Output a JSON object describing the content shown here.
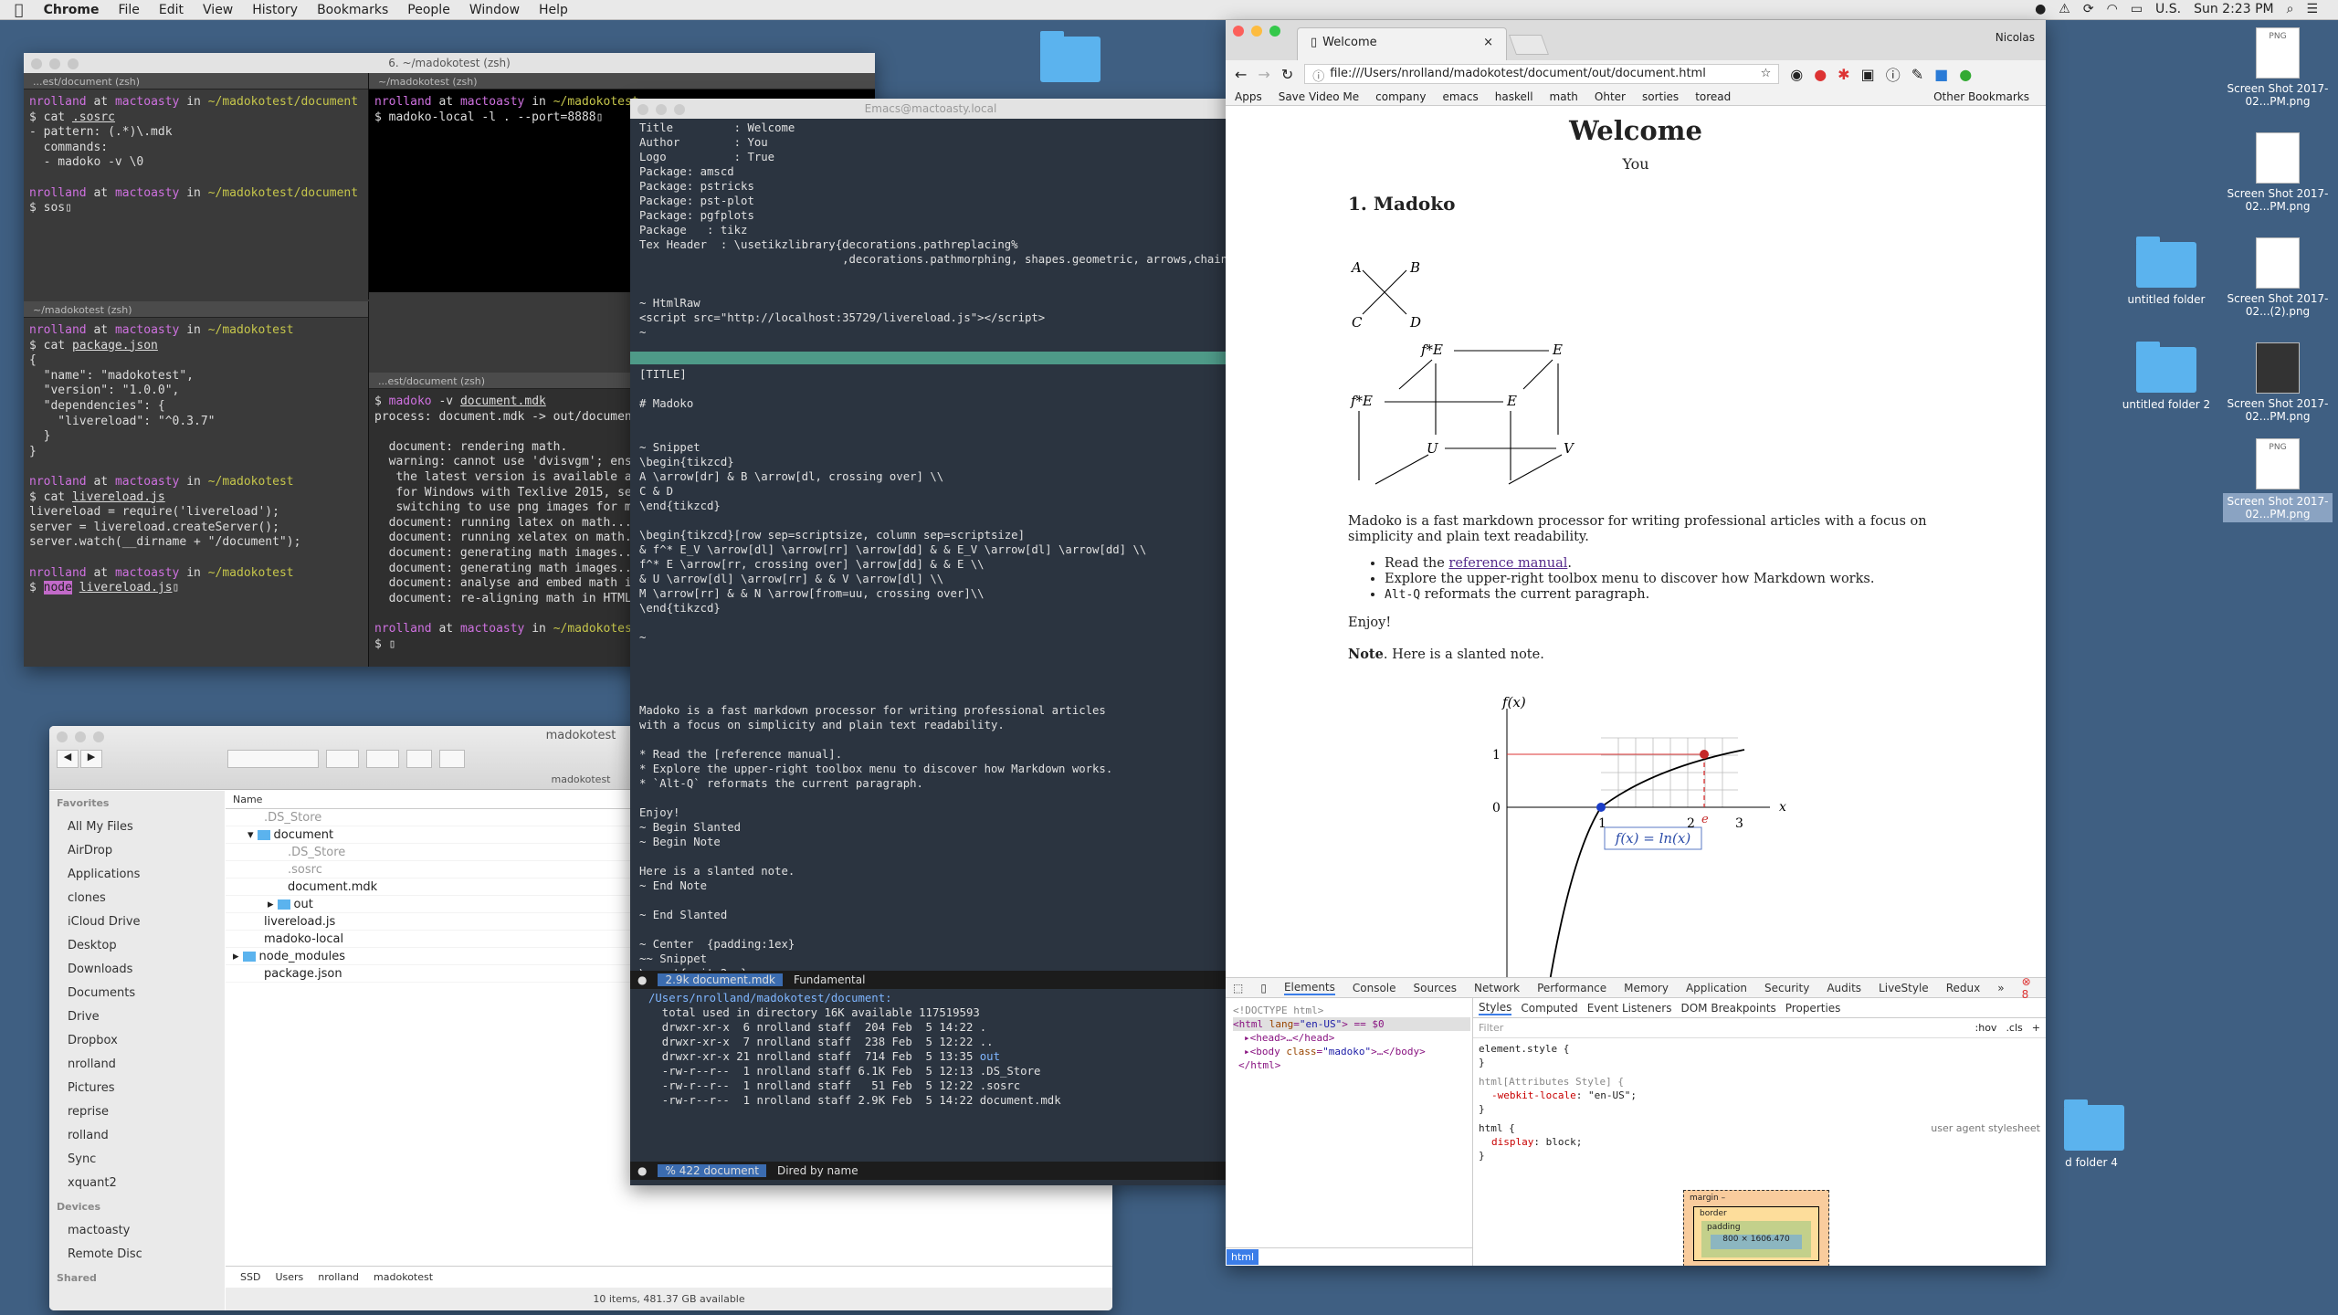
{
  "menubar": {
    "apple": "",
    "app": "Chrome",
    "items": [
      "File",
      "Edit",
      "View",
      "History",
      "Bookmarks",
      "People",
      "Window",
      "Help"
    ],
    "input": "U.S.",
    "clock": "Sun 2:23 PM"
  },
  "desktop": {
    "ss1": "Screen Shot 2017-02...PM.png",
    "ss2": "Screen Shot 2017-02...PM.png",
    "ss3": "Screen Shot 2017-02...(2).png",
    "ss4": "Screen Shot 2017-02...PM.png",
    "ss5": "Screen Shot 2017-02...PM.png",
    "folder1": "untitled folder",
    "folder2": "untitled folder 2",
    "folder4": "d folder 4",
    "png": "PNG"
  },
  "term1": {
    "title": "6. ~/madokotest (zsh)",
    "tab_left": "...est/document (zsh)",
    "tab_right": "~/madokotest (zsh)",
    "tab_bottom": "~/madokotest (zsh)",
    "tab_midright": "...est/document (zsh)"
  },
  "emacs": {
    "title": "Emacs@mactoasty.local",
    "mode1_file": "2.9k document.mdk",
    "mode1_mode": "Fundamental",
    "mode2_file": "% 422 document",
    "mode2_mode": "Dired by name"
  },
  "finder": {
    "title": "madokotest",
    "path_title": "madokotest",
    "col_name": "Name",
    "favorites": "Favorites",
    "devices": "Devices",
    "shared": "Shared",
    "side": [
      "All My Files",
      "AirDrop",
      "Applications",
      "clones",
      "iCloud Drive",
      "Desktop",
      "Downloads",
      "Documents",
      "Drive",
      "Dropbox",
      "nrolland",
      "Pictures",
      "reprise",
      "rolland",
      "Sync",
      "xquant2"
    ],
    "devs": [
      "mactoasty",
      "Remote Disc"
    ],
    "files": [
      ".DS_Store",
      "document",
      ".DS_Store",
      ".sosrc",
      "document.mdk",
      "out",
      "livereload.js",
      "madoko-local",
      "node_modules",
      "package.json"
    ],
    "path": [
      "SSD",
      "Users",
      "nrolland",
      "madokotest"
    ],
    "status": "10 items, 481.37 GB available"
  },
  "chrome": {
    "tab": "Welcome",
    "user": "Nicolas",
    "url": "file:///Users/nrolland/madokotest/document/out/document.html",
    "bookmarks": [
      "Apps",
      "Save Video Me",
      "company",
      "emacs",
      "haskell",
      "math",
      "Ohter",
      "sorties",
      "toread"
    ],
    "other": "Other Bookmarks",
    "doc": {
      "title": "Welcome",
      "author": "You",
      "h1": "1.  Madoko",
      "p1": "Madoko is a fast markdown processor for writing professional articles with a focus on simplicity and plain text readability.",
      "li1a": "Read the ",
      "li1b": "reference manual",
      "li1c": ".",
      "li2": "Explore the upper-right toolbox menu to discover how Markdown works.",
      "li3a": "Alt-Q",
      "li3b": " reformats the current paragraph.",
      "enjoy": "Enjoy!",
      "note_b": "Note",
      "note": ". Here is a slanted note.",
      "fx": "f(x)",
      "formula": "f(x) = ln(x)",
      "e": "e",
      "x": "x"
    },
    "devtools": {
      "tabs": [
        "Elements",
        "Console",
        "Sources",
        "Network",
        "Performance",
        "Memory",
        "Application",
        "Security",
        "Audits",
        "LiveStyle",
        "Redux"
      ],
      "errors": "8",
      "styles_tabs": [
        "Styles",
        "Computed",
        "Event Listeners",
        "DOM Breakpoints",
        "Properties"
      ],
      "filter": "Filter",
      "hov": ":hov",
      "cls": ".cls",
      "bottom": "html",
      "box_margin": "margin",
      "box_border": "border",
      "box_padding": "padding",
      "box_size": "800 × 1606.470",
      "dash": "–",
      "ua": "user agent stylesheet"
    }
  }
}
